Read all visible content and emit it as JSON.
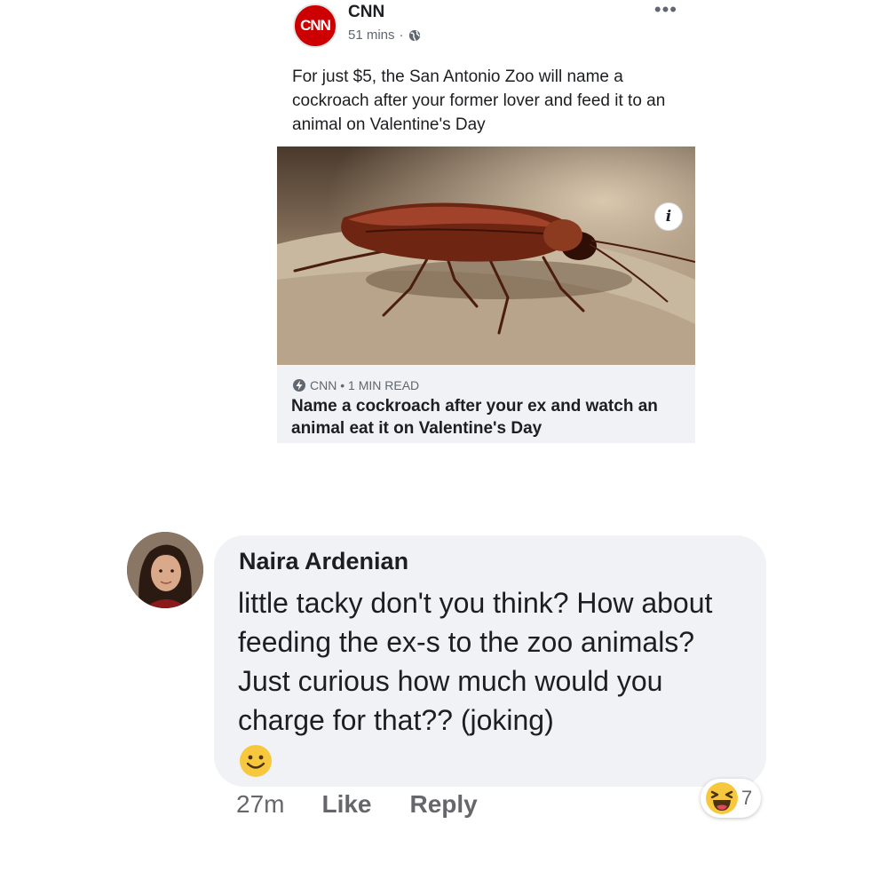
{
  "post": {
    "page_name": "CNN",
    "logo_text": "CNN",
    "timestamp": "51 mins",
    "separator": "·",
    "privacy_icon": "globe-icon",
    "more_icon": "more-dots-icon",
    "text": "For just $5, the San Antonio Zoo will name a cockroach after your former lover and feed it to an animal on Valentine's Day",
    "link": {
      "image_icon": "cockroach-photo",
      "info_label": "i",
      "source_icon": "bolt-icon",
      "source": "CNN • 1 MIN READ",
      "title": "Name a cockroach after your ex and watch an animal eat it on Valentine's Day"
    }
  },
  "comment": {
    "author": "Naira Ardenian",
    "avatar_icon": "avatar-photo",
    "text": "little tacky don't you think? How about feeding the ex-s to the zoo animals? Just curious how much would you charge for that?? (joking)",
    "emoji_icon": "smiley-icon",
    "time": "27m",
    "like_label": "Like",
    "reply_label": "Reply",
    "reaction_icon": "haha-icon",
    "reaction_count": "7"
  },
  "colors": {
    "brand_red": "#cc0000",
    "bubble_bg": "#f0f2f5",
    "muted_text": "#65676b"
  }
}
